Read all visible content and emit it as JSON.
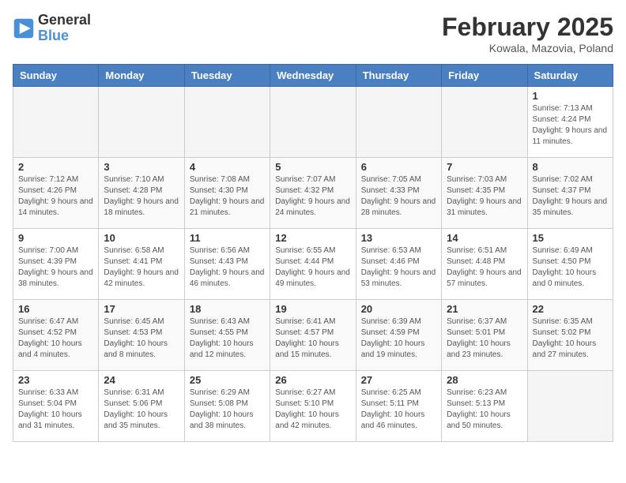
{
  "header": {
    "logo_general": "General",
    "logo_blue": "Blue",
    "title": "February 2025",
    "subtitle": "Kowala, Mazovia, Poland"
  },
  "days_of_week": [
    "Sunday",
    "Monday",
    "Tuesday",
    "Wednesday",
    "Thursday",
    "Friday",
    "Saturday"
  ],
  "weeks": [
    [
      {
        "day": "",
        "info": ""
      },
      {
        "day": "",
        "info": ""
      },
      {
        "day": "",
        "info": ""
      },
      {
        "day": "",
        "info": ""
      },
      {
        "day": "",
        "info": ""
      },
      {
        "day": "",
        "info": ""
      },
      {
        "day": "1",
        "info": "Sunrise: 7:13 AM\nSunset: 4:24 PM\nDaylight: 9 hours and 11 minutes."
      }
    ],
    [
      {
        "day": "2",
        "info": "Sunrise: 7:12 AM\nSunset: 4:26 PM\nDaylight: 9 hours and 14 minutes."
      },
      {
        "day": "3",
        "info": "Sunrise: 7:10 AM\nSunset: 4:28 PM\nDaylight: 9 hours and 18 minutes."
      },
      {
        "day": "4",
        "info": "Sunrise: 7:08 AM\nSunset: 4:30 PM\nDaylight: 9 hours and 21 minutes."
      },
      {
        "day": "5",
        "info": "Sunrise: 7:07 AM\nSunset: 4:32 PM\nDaylight: 9 hours and 24 minutes."
      },
      {
        "day": "6",
        "info": "Sunrise: 7:05 AM\nSunset: 4:33 PM\nDaylight: 9 hours and 28 minutes."
      },
      {
        "day": "7",
        "info": "Sunrise: 7:03 AM\nSunset: 4:35 PM\nDaylight: 9 hours and 31 minutes."
      },
      {
        "day": "8",
        "info": "Sunrise: 7:02 AM\nSunset: 4:37 PM\nDaylight: 9 hours and 35 minutes."
      }
    ],
    [
      {
        "day": "9",
        "info": "Sunrise: 7:00 AM\nSunset: 4:39 PM\nDaylight: 9 hours and 38 minutes."
      },
      {
        "day": "10",
        "info": "Sunrise: 6:58 AM\nSunset: 4:41 PM\nDaylight: 9 hours and 42 minutes."
      },
      {
        "day": "11",
        "info": "Sunrise: 6:56 AM\nSunset: 4:43 PM\nDaylight: 9 hours and 46 minutes."
      },
      {
        "day": "12",
        "info": "Sunrise: 6:55 AM\nSunset: 4:44 PM\nDaylight: 9 hours and 49 minutes."
      },
      {
        "day": "13",
        "info": "Sunrise: 6:53 AM\nSunset: 4:46 PM\nDaylight: 9 hours and 53 minutes."
      },
      {
        "day": "14",
        "info": "Sunrise: 6:51 AM\nSunset: 4:48 PM\nDaylight: 9 hours and 57 minutes."
      },
      {
        "day": "15",
        "info": "Sunrise: 6:49 AM\nSunset: 4:50 PM\nDaylight: 10 hours and 0 minutes."
      }
    ],
    [
      {
        "day": "16",
        "info": "Sunrise: 6:47 AM\nSunset: 4:52 PM\nDaylight: 10 hours and 4 minutes."
      },
      {
        "day": "17",
        "info": "Sunrise: 6:45 AM\nSunset: 4:53 PM\nDaylight: 10 hours and 8 minutes."
      },
      {
        "day": "18",
        "info": "Sunrise: 6:43 AM\nSunset: 4:55 PM\nDaylight: 10 hours and 12 minutes."
      },
      {
        "day": "19",
        "info": "Sunrise: 6:41 AM\nSunset: 4:57 PM\nDaylight: 10 hours and 15 minutes."
      },
      {
        "day": "20",
        "info": "Sunrise: 6:39 AM\nSunset: 4:59 PM\nDaylight: 10 hours and 19 minutes."
      },
      {
        "day": "21",
        "info": "Sunrise: 6:37 AM\nSunset: 5:01 PM\nDaylight: 10 hours and 23 minutes."
      },
      {
        "day": "22",
        "info": "Sunrise: 6:35 AM\nSunset: 5:02 PM\nDaylight: 10 hours and 27 minutes."
      }
    ],
    [
      {
        "day": "23",
        "info": "Sunrise: 6:33 AM\nSunset: 5:04 PM\nDaylight: 10 hours and 31 minutes."
      },
      {
        "day": "24",
        "info": "Sunrise: 6:31 AM\nSunset: 5:06 PM\nDaylight: 10 hours and 35 minutes."
      },
      {
        "day": "25",
        "info": "Sunrise: 6:29 AM\nSunset: 5:08 PM\nDaylight: 10 hours and 38 minutes."
      },
      {
        "day": "26",
        "info": "Sunrise: 6:27 AM\nSunset: 5:10 PM\nDaylight: 10 hours and 42 minutes."
      },
      {
        "day": "27",
        "info": "Sunrise: 6:25 AM\nSunset: 5:11 PM\nDaylight: 10 hours and 46 minutes."
      },
      {
        "day": "28",
        "info": "Sunrise: 6:23 AM\nSunset: 5:13 PM\nDaylight: 10 hours and 50 minutes."
      },
      {
        "day": "",
        "info": ""
      }
    ]
  ]
}
